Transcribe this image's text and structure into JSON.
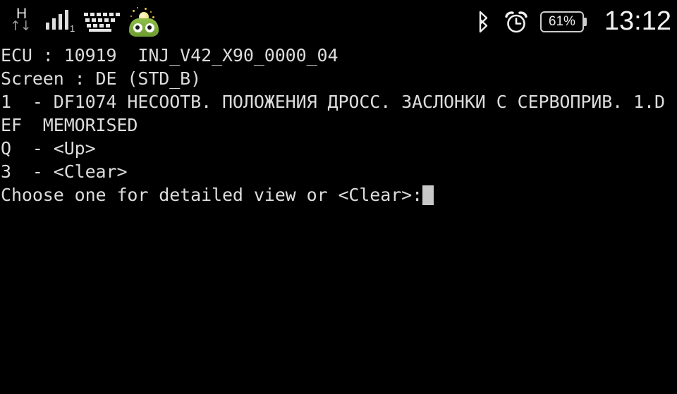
{
  "status_bar": {
    "network_type": "H",
    "network_arrows": "↑↓",
    "sim_number": "1",
    "keyboard_icon": "keyboard-icon",
    "app_icon": "green-creature-icon",
    "bluetooth_icon": "bluetooth-icon",
    "alarm_icon": "alarm-clock-icon",
    "battery_percent": "61%",
    "time": "13:12"
  },
  "terminal": {
    "lines": [
      "ECU : 10919  INJ_V42_X90_0000_04",
      "Screen : DE (STD_B)",
      "1  - DF1074 НЕСООТВ. ПОЛОЖЕНИЯ ДРОСС. ЗАСЛОНКИ С СЕРВОПРИВ. 1.D",
      "EF  MEMORISED",
      "Q  - <Up>",
      "3  - <Clear>"
    ],
    "prompt": "Choose one for detailed view or <Clear>:",
    "cursor": "block-cursor"
  },
  "colors": {
    "background": "#000000",
    "text": "#dcdcdc",
    "status_icon": "#e6e6e6",
    "creature_green": "#7fae3e",
    "cursor": "#c8c8c8"
  }
}
